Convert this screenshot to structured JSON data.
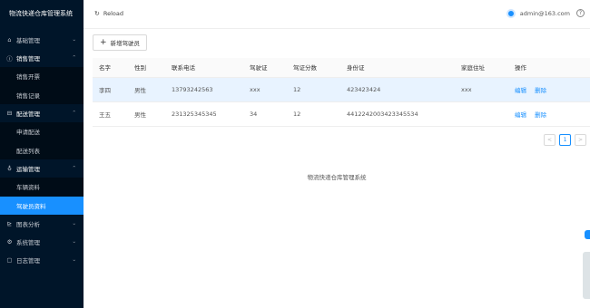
{
  "sidebar": {
    "brand": "物流快递仓库管理系统",
    "groups": [
      {
        "label": "基础管理",
        "icon": "home-icon"
      },
      {
        "label": "销售管理",
        "icon": "info-circle-icon",
        "items": [
          "销售开票",
          "销售记录"
        ]
      },
      {
        "label": "配送管理",
        "icon": "car-icon",
        "items": [
          "申请配送",
          "配送列表"
        ]
      },
      {
        "label": "运输管理",
        "icon": "truck-icon",
        "items": [
          "车辆资料",
          "驾驶员资料"
        ]
      },
      {
        "label": "图表分析",
        "icon": "chart-icon"
      },
      {
        "label": "系统管理",
        "icon": "settings-icon"
      },
      {
        "label": "日志管理",
        "icon": "file-icon"
      }
    ]
  },
  "header": {
    "reload_label": "Reload",
    "user_email": "admin@163.com",
    "help_glyph": "?"
  },
  "toolbar": {
    "add_label": "新增驾驶员"
  },
  "table": {
    "columns": [
      "名字",
      "性别",
      "联系电话",
      "驾驶证",
      "驾证分数",
      "身份证",
      "家庭住址",
      "操作"
    ],
    "rows": [
      {
        "name": "李四",
        "gender": "男性",
        "phone": "13793242563",
        "license": "xxx",
        "score": "12",
        "id_card": "423423424",
        "address": "xxx",
        "edit": "编辑",
        "delete": "删除"
      },
      {
        "name": "王五",
        "gender": "男性",
        "phone": "231325345345",
        "license": "34",
        "score": "12",
        "id_card": "4412242003423345534",
        "address": "",
        "edit": "编辑",
        "delete": "删除"
      }
    ]
  },
  "pagination": {
    "prev": "<",
    "current": "1",
    "next": ">"
  },
  "footer": "物流快递仓库管理系统",
  "colors": {
    "sidebar_bg": "#001529",
    "accent": "#1890ff"
  }
}
